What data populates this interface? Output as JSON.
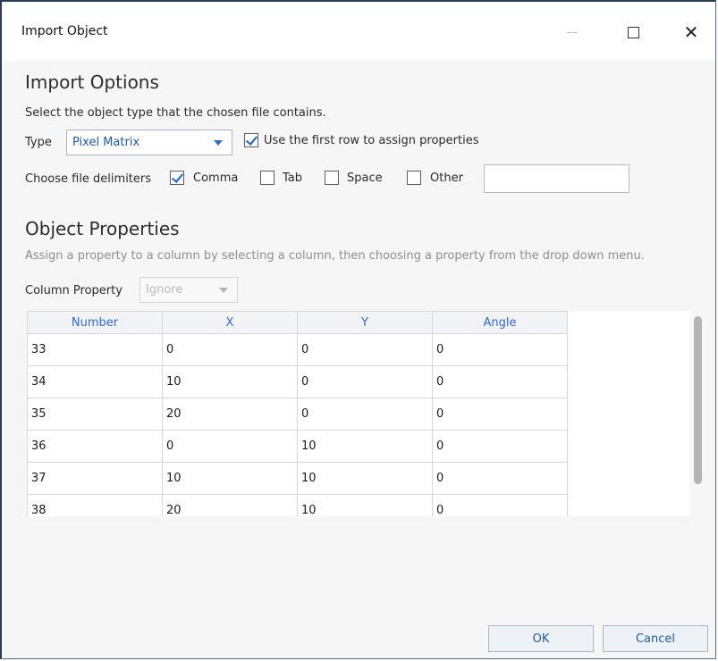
{
  "window": {
    "title": "Import Object",
    "controls": [
      "minimize-icon",
      "maximize-icon",
      "close-icon"
    ],
    "close_glyph": "✕"
  },
  "import_options": {
    "heading": "Import Options",
    "instruction": "Select the object type that the chosen file contains.",
    "type_label": "Type",
    "type_value": "Pixel Matrix",
    "use_first_row": {
      "label": "Use the first row to assign properties",
      "checked": true
    },
    "delimiters_label": "Choose file delimiters",
    "delimiters": [
      {
        "label": "Comma",
        "checked": true
      },
      {
        "label": "Tab",
        "checked": false
      },
      {
        "label": "Space",
        "checked": false
      },
      {
        "label": "Other",
        "checked": false
      }
    ],
    "other_value": ""
  },
  "object_properties": {
    "heading": "Object Properties",
    "instruction": "Assign a property to a column by selecting a column, then choosing a property from the drop down menu.",
    "column_property_label": "Column Property",
    "column_property_value": "Ignore"
  },
  "table": {
    "columns": [
      "Number",
      "X",
      "Y",
      "Angle"
    ],
    "rows": [
      [
        "33",
        "0",
        "0",
        "0"
      ],
      [
        "34",
        "10",
        "0",
        "0"
      ],
      [
        "35",
        "20",
        "0",
        "0"
      ],
      [
        "36",
        "0",
        "10",
        "0"
      ],
      [
        "37",
        "10",
        "10",
        "0"
      ],
      [
        "38",
        "20",
        "10",
        "0"
      ]
    ]
  },
  "buttons": {
    "ok": "OK",
    "cancel": "Cancel"
  },
  "colors": {
    "accent": "#2a6fd6",
    "header_text": "#2d6bd3"
  }
}
